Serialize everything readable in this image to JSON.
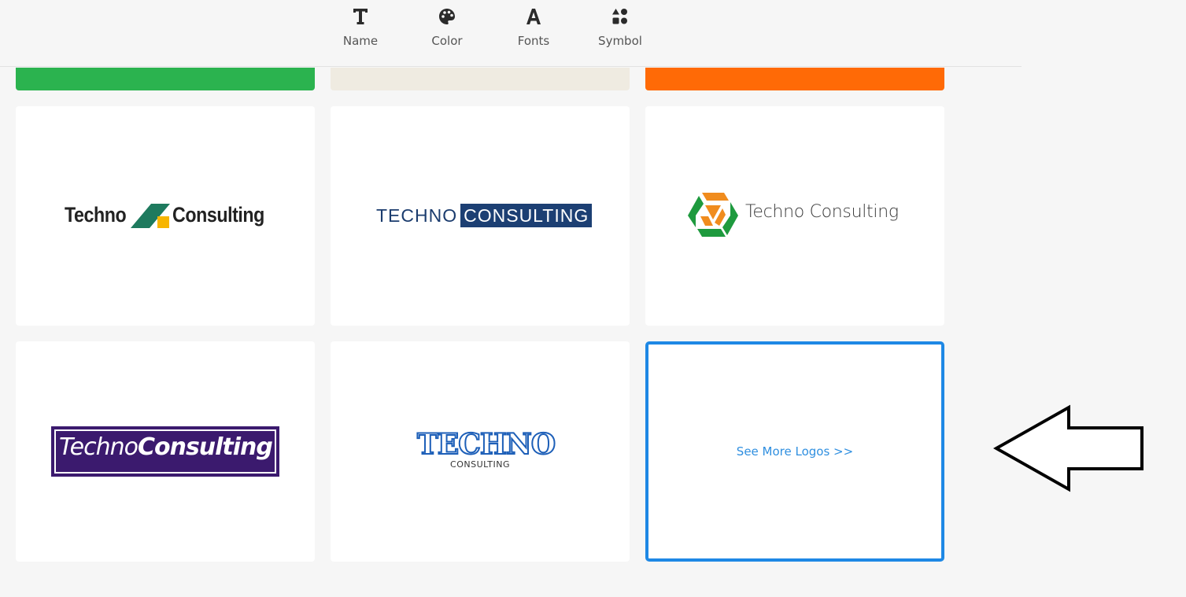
{
  "toolbar": {
    "items": [
      {
        "label": "Name",
        "icon": "text-t-icon"
      },
      {
        "label": "Color",
        "icon": "palette-icon"
      },
      {
        "label": "Fonts",
        "icon": "font-a-icon"
      },
      {
        "label": "Symbol",
        "icon": "shapes-icon"
      }
    ]
  },
  "top_strips": [
    {
      "color": "#2bb34f"
    },
    {
      "color": "#efebe1"
    },
    {
      "color": "#ff6a06"
    }
  ],
  "logos": {
    "logo1": {
      "word1": "Techno",
      "word2": "Consulting"
    },
    "logo2": {
      "word1": "TECHNO",
      "word2": "CONSULTING"
    },
    "logo3": {
      "text": "Techno Consulting"
    },
    "logo4": {
      "word1": "Techno",
      "word2": "Consulting"
    },
    "logo5": {
      "word1": "TECHNO",
      "word2": "CONSULTING"
    }
  },
  "see_more": {
    "label": "See More Logos >>"
  },
  "colors": {
    "accent": "#1e88e5",
    "link": "#2f8fe0"
  }
}
